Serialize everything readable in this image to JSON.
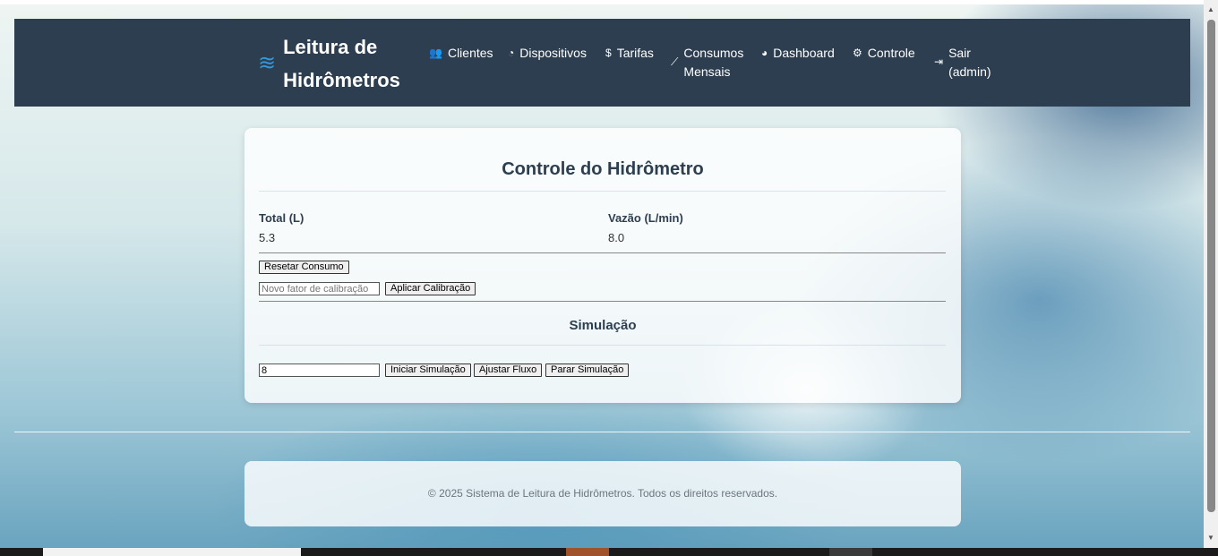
{
  "navbar": {
    "brand_icon": "water-icon",
    "brand_line1": "Leitura de",
    "brand_line2": "Hidrômetros",
    "items": [
      {
        "label": "Clientes",
        "icon": "users-icon",
        "glyph": "👥"
      },
      {
        "label": "Dispositivos",
        "icon": "gauge-icon",
        "glyph": "◔"
      },
      {
        "label": "Tarifas",
        "icon": "dollar-icon",
        "glyph": "$"
      },
      {
        "label_line1": "Consumos",
        "label_line2": "Mensais",
        "icon": "chart-line-icon",
        "glyph": "⟋"
      },
      {
        "label": "Dashboard",
        "icon": "pie-chart-icon",
        "glyph": "◕"
      },
      {
        "label": "Controle",
        "icon": "cogs-icon",
        "glyph": "⚙"
      },
      {
        "label_line1": "Sair",
        "label_line2": "(admin)",
        "icon": "sign-out-icon",
        "glyph": "⇥"
      }
    ]
  },
  "control": {
    "title": "Controle do Hidrômetro",
    "total_label": "Total (L)",
    "total_value": "5.3",
    "flow_label": "Vazão (L/min)",
    "flow_value": "8.0",
    "reset_button": "Resetar Consumo",
    "calibration_placeholder": "Novo fator de calibração",
    "calibration_value": "",
    "apply_calibration_button": "Aplicar Calibração"
  },
  "simulation": {
    "title": "Simulação",
    "flow_input_value": "8",
    "start_button": "Iniciar Simulação",
    "adjust_button": "Ajustar Fluxo",
    "stop_button": "Parar Simulação"
  },
  "footer": {
    "text": "© 2025 Sistema de Leitura de Hidrômetros. Todos os direitos reservados."
  },
  "colors": {
    "navbar_bg": "#2c3e50",
    "brand_icon": "#3498db",
    "heading": "#2c3e50"
  }
}
